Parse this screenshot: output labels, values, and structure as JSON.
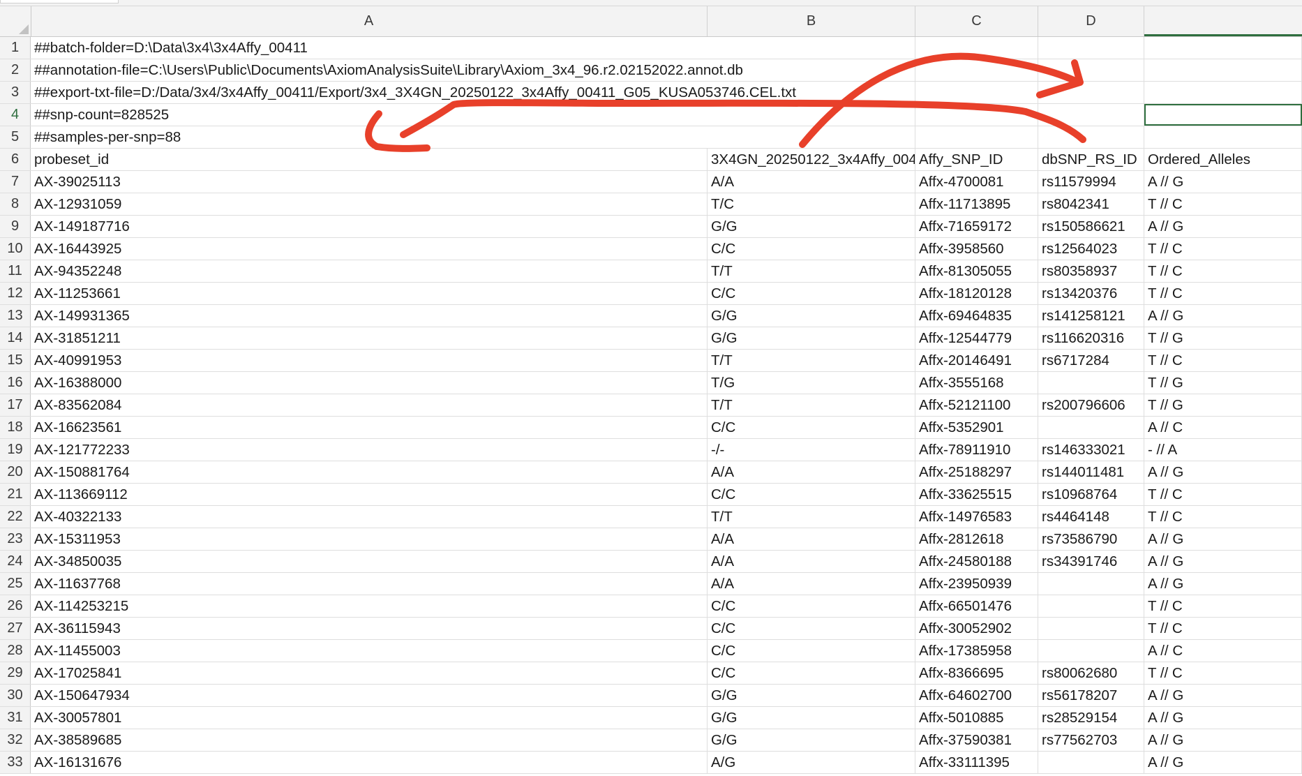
{
  "columns": [
    "A",
    "B",
    "C",
    "D",
    ""
  ],
  "meta_rows": [
    {
      "num": "1",
      "text": "##batch-folder=D:\\Data\\3x4\\3x4Affy_00411"
    },
    {
      "num": "2",
      "text": "##annotation-file=C:\\Users\\Public\\Documents\\AxiomAnalysisSuite\\Library\\Axiom_3x4_96.r2.02152022.annot.db"
    },
    {
      "num": "3",
      "text": "##export-txt-file=D:/Data/3x4/3x4Affy_00411/Export/3x4_3X4GN_20250122_3x4Affy_00411_G05_KUSA053746.CEL.txt"
    },
    {
      "num": "4",
      "text": "##snp-count=828525"
    },
    {
      "num": "5",
      "text": "##samples-per-snp=88"
    }
  ],
  "header_row": {
    "num": "6",
    "cells": [
      "probeset_id",
      "3X4GN_20250122_3x4Affy_004",
      "Affy_SNP_ID",
      "dbSNP_RS_ID",
      "Ordered_Alleles"
    ]
  },
  "data_rows": [
    {
      "num": "7",
      "cells": [
        "AX-39025113",
        "A/A",
        "Affx-4700081",
        "rs11579994",
        "A // G"
      ]
    },
    {
      "num": "8",
      "cells": [
        "AX-12931059",
        "T/C",
        "Affx-11713895",
        "rs8042341",
        "T // C"
      ]
    },
    {
      "num": "9",
      "cells": [
        "AX-149187716",
        "G/G",
        "Affx-71659172",
        "rs150586621",
        "A // G"
      ]
    },
    {
      "num": "10",
      "cells": [
        "AX-16443925",
        "C/C",
        "Affx-3958560",
        "rs12564023",
        "T // C"
      ]
    },
    {
      "num": "11",
      "cells": [
        "AX-94352248",
        "T/T",
        "Affx-81305055",
        "rs80358937",
        "T // C"
      ]
    },
    {
      "num": "12",
      "cells": [
        "AX-11253661",
        "C/C",
        "Affx-18120128",
        "rs13420376",
        "T // C"
      ]
    },
    {
      "num": "13",
      "cells": [
        "AX-149931365",
        "G/G",
        "Affx-69464835",
        "rs141258121",
        "A // G"
      ]
    },
    {
      "num": "14",
      "cells": [
        "AX-31851211",
        "G/G",
        "Affx-12544779",
        "rs116620316",
        "T // G"
      ]
    },
    {
      "num": "15",
      "cells": [
        "AX-40991953",
        "T/T",
        "Affx-20146491",
        "rs6717284",
        "T // C"
      ]
    },
    {
      "num": "16",
      "cells": [
        "AX-16388000",
        "T/G",
        "Affx-3555168",
        "",
        "T // G"
      ]
    },
    {
      "num": "17",
      "cells": [
        "AX-83562084",
        "T/T",
        "Affx-52121100",
        "rs200796606",
        "T // G"
      ]
    },
    {
      "num": "18",
      "cells": [
        "AX-16623561",
        "C/C",
        "Affx-5352901",
        "",
        "A // C"
      ]
    },
    {
      "num": "19",
      "cells": [
        "AX-121772233",
        "-/-",
        "Affx-78911910",
        "rs146333021",
        "- // A"
      ]
    },
    {
      "num": "20",
      "cells": [
        "AX-150881764",
        "A/A",
        "Affx-25188297",
        "rs144011481",
        "A // G"
      ]
    },
    {
      "num": "21",
      "cells": [
        "AX-113669112",
        "C/C",
        "Affx-33625515",
        "rs10968764",
        "T // C"
      ]
    },
    {
      "num": "22",
      "cells": [
        "AX-40322133",
        "T/T",
        "Affx-14976583",
        "rs4464148",
        "T // C"
      ]
    },
    {
      "num": "23",
      "cells": [
        "AX-15311953",
        "A/A",
        "Affx-2812618",
        "rs73586790",
        "A // G"
      ]
    },
    {
      "num": "24",
      "cells": [
        "AX-34850035",
        "A/A",
        "Affx-24580188",
        "rs34391746",
        "A // G"
      ]
    },
    {
      "num": "25",
      "cells": [
        "AX-11637768",
        "A/A",
        "Affx-23950939",
        "",
        "A // G"
      ]
    },
    {
      "num": "26",
      "cells": [
        "AX-114253215",
        "C/C",
        "Affx-66501476",
        "",
        "T // C"
      ]
    },
    {
      "num": "27",
      "cells": [
        "AX-36115943",
        "C/C",
        "Affx-30052902",
        "",
        "T // C"
      ]
    },
    {
      "num": "28",
      "cells": [
        "AX-11455003",
        "C/C",
        "Affx-17385958",
        "",
        "A // C"
      ]
    },
    {
      "num": "29",
      "cells": [
        "AX-17025841",
        "C/C",
        "Affx-8366695",
        "rs80062680",
        "T // C"
      ]
    },
    {
      "num": "30",
      "cells": [
        "AX-150647934",
        "G/G",
        "Affx-64602700",
        "rs56178207",
        "A // G"
      ]
    },
    {
      "num": "31",
      "cells": [
        "AX-30057801",
        "G/G",
        "Affx-5010885",
        "rs28529154",
        "A // G"
      ]
    },
    {
      "num": "32",
      "cells": [
        "AX-38589685",
        "G/G",
        "Affx-37590381",
        "rs77562703",
        "A // G"
      ]
    },
    {
      "num": "33",
      "cells": [
        "AX-16131676",
        "A/G",
        "Affx-33111395",
        "",
        "A // G"
      ]
    }
  ],
  "selection": {
    "row": "4",
    "column": "E"
  },
  "colors": {
    "annotation_stroke": "#e8402a",
    "selection": "#2e6e3e"
  }
}
